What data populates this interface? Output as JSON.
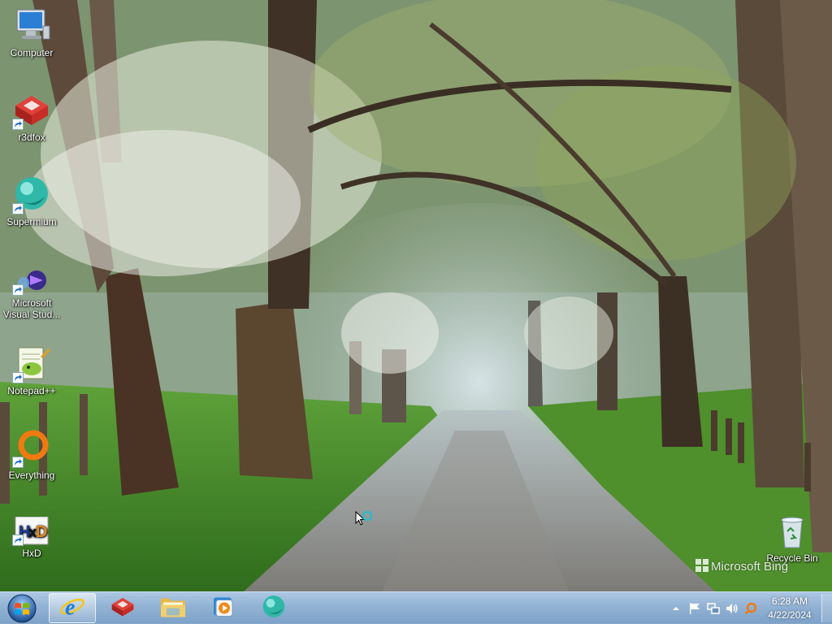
{
  "desktop": {
    "icons": [
      {
        "label": "Computer",
        "icon": "computer-icon"
      },
      {
        "label": "r3dfox",
        "icon": "r3dfox-icon"
      },
      {
        "label": "Supermium",
        "icon": "supermium-icon"
      },
      {
        "label": "Microsoft Visual Stud...",
        "icon": "visual-studio-icon"
      },
      {
        "label": "Notepad++",
        "icon": "notepadpp-icon"
      },
      {
        "label": "Everything",
        "icon": "everything-icon"
      },
      {
        "label": "HxD",
        "icon": "hxd-icon"
      },
      {
        "label": "Recycle Bin",
        "icon": "recycle-bin-icon"
      }
    ],
    "watermark": "Microsoft Bing"
  },
  "taskbar": {
    "pinned": [
      {
        "name": "Internet Explorer",
        "icon": "ie-icon",
        "active": true
      },
      {
        "name": "r3dfox",
        "icon": "r3dfox-icon",
        "active": false
      },
      {
        "name": "Windows Explorer",
        "icon": "folder-icon",
        "active": false
      },
      {
        "name": "Windows Media Player",
        "icon": "media-player-icon",
        "active": false
      },
      {
        "name": "Supermium",
        "icon": "supermium-icon",
        "active": false
      }
    ],
    "tray": {
      "icons": [
        "show-hidden-icons-arrow",
        "action-center-flag-icon",
        "network-icon",
        "volume-icon",
        "search-icon"
      ],
      "time": "6:28 AM",
      "date": "4/22/2024"
    }
  },
  "colors": {
    "taskbar": "#8caed2",
    "accent_ie": "#1f7ad6",
    "r3dfox_red": "#d6322c",
    "supermium_teal": "#2fb8a8",
    "everything_orange": "#f07a12"
  }
}
